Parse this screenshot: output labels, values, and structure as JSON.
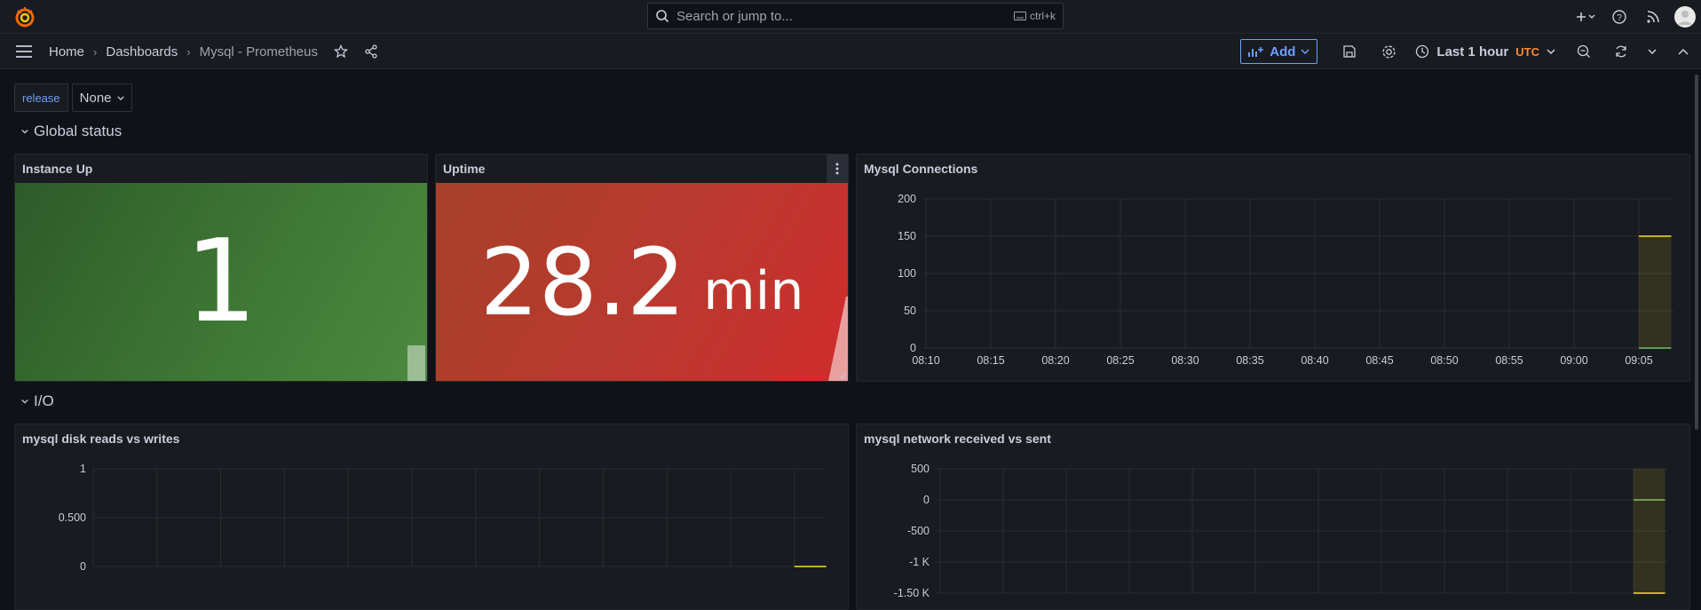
{
  "topbar": {
    "search_placeholder": "Search or jump to...",
    "search_shortcut": "ctrl+k"
  },
  "breadcrumb": [
    "Home",
    "Dashboards",
    "Mysql - Prometheus"
  ],
  "toolbar": {
    "add_label": "Add",
    "time_range": "Last 1 hour",
    "timezone": "UTC"
  },
  "variables": {
    "label": "release",
    "value": "None"
  },
  "rows": {
    "global": "Global status",
    "io": "I/O"
  },
  "panels": {
    "instance_up": {
      "title": "Instance Up",
      "value": "1",
      "color": "#37872d"
    },
    "uptime": {
      "title": "Uptime",
      "value": "28.2",
      "unit": "min",
      "color": "#c4162a"
    },
    "connections": {
      "title": "Mysql Connections"
    },
    "disk": {
      "title": "mysql disk reads vs writes"
    },
    "network": {
      "title": "mysql network received vs sent"
    }
  },
  "chart_data": [
    {
      "type": "line",
      "title": "Mysql Connections",
      "x": [
        "08:10",
        "08:15",
        "08:20",
        "08:25",
        "08:30",
        "08:35",
        "08:40",
        "08:45",
        "08:50",
        "08:55",
        "09:00",
        "09:05"
      ],
      "yticks": [
        "200",
        "150",
        "100",
        "50",
        "0"
      ],
      "ylim": [
        0,
        200
      ],
      "series": [
        {
          "color": "#fade2a",
          "values": [
            [
              12,
              150
            ],
            [
              12.5,
              150
            ]
          ]
        },
        {
          "color": "#73bf69",
          "values": [
            [
              12,
              0
            ],
            [
              12.5,
              0
            ]
          ]
        }
      ]
    },
    {
      "type": "line",
      "title": "mysql disk reads vs writes",
      "yticks": [
        "1",
        "0.500",
        "0"
      ],
      "ylim": [
        0,
        1
      ],
      "series": [
        {
          "color": "#fade2a",
          "values": [
            [
              12,
              0
            ],
            [
              12.5,
              0
            ]
          ]
        }
      ]
    },
    {
      "type": "line",
      "title": "mysql network received vs sent",
      "yticks": [
        "500",
        "0",
        "-500",
        "-1 K",
        "-1.50 K"
      ],
      "ylim": [
        -1500,
        500
      ],
      "series": [
        {
          "color": "#73bf69",
          "values": [
            [
              12,
              0
            ],
            [
              12.5,
              0
            ]
          ]
        },
        {
          "color": "#fade2a",
          "values": [
            [
              12,
              -1500
            ],
            [
              12.5,
              -1500
            ]
          ]
        }
      ]
    }
  ]
}
